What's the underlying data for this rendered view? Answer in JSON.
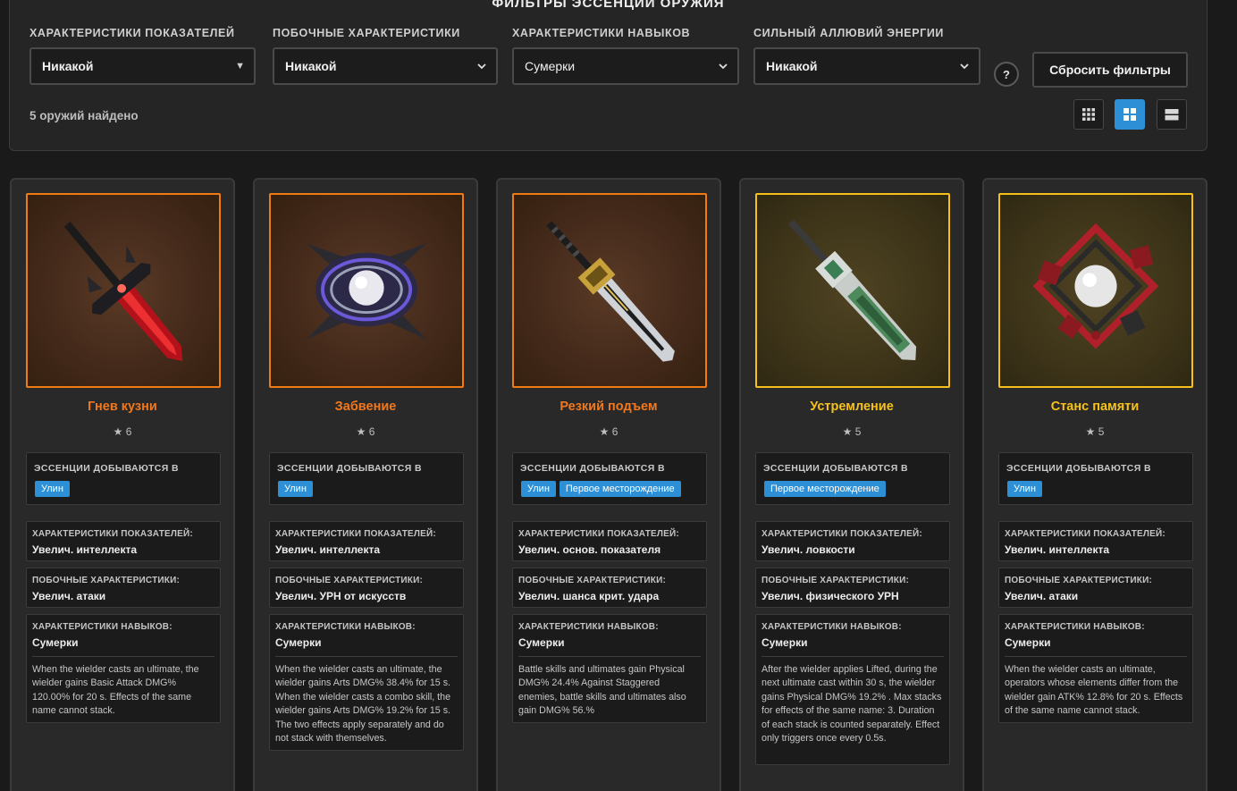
{
  "filters": {
    "title": "ФИЛЬТРЫ ЭССЕНЦИЙ ОРУЖИЯ",
    "groups": [
      {
        "label": "ХАРАКТЕРИСТИКИ ПОКАЗАТЕЛЕЙ",
        "value": "Никакой"
      },
      {
        "label": "ПОБОЧНЫЕ ХАРАКТЕРИСТИКИ",
        "value": "Никакой"
      },
      {
        "label": "ХАРАКТЕРИСТИКИ НАВЫКОВ",
        "value": "Сумерки"
      },
      {
        "label": "СИЛЬНЫЙ АЛЛЮВИЙ ЭНЕРГИИ",
        "value": "Никакой"
      }
    ],
    "help_label": "?",
    "reset_label": "Сбросить фильтры",
    "found_text": "5 оружий найдено",
    "view_modes": [
      "grid-small-icon",
      "grid-large-icon",
      "list-icon"
    ],
    "active_view": "grid-large-icon"
  },
  "labels": {
    "source": "ЭССЕНЦИИ ДОБЫВАЮТСЯ В",
    "primary": "ХАРАКТЕРИСТИКИ ПОКАЗАТЕЛЕЙ:",
    "secondary": "ПОБОЧНЫЕ ХАРАКТЕРИСТИКИ:",
    "skill": "ХАРАКТЕРИСТИКИ НАВЫКОВ:"
  },
  "colors": {
    "rarity6": "#f07b12",
    "rarity5": "#f6bf19",
    "accent": "#2d8fd6"
  },
  "weapons": [
    {
      "name": "Гнев кузни",
      "rarity": "★ 6",
      "sources": [
        "Улин"
      ],
      "primary": "Увелич. интеллекта",
      "secondary": "Увелич. атаки",
      "skill": "Сумерки",
      "skill_desc": "When the wielder casts an ultimate, the wielder gains Basic Attack DMG% 120.00% for 20 s. Effects of the same name cannot stack."
    },
    {
      "name": "Забвение",
      "rarity": "★ 6",
      "sources": [
        "Улин"
      ],
      "primary": "Увелич. интеллекта",
      "secondary": "Увелич. УРН от искусств",
      "skill": "Сумерки",
      "skill_desc": "When the wielder casts an ultimate, the wielder gains Arts DMG% 38.4% for 15 s. When the wielder casts a combo skill, the wielder gains Arts DMG% 19.2% for 15 s. The two effects apply separately and do not stack with themselves."
    },
    {
      "name": "Резкий подъем",
      "rarity": "★ 6",
      "sources": [
        "Улин",
        "Первое месторождение"
      ],
      "primary": "Увелич. основ. показателя",
      "secondary": "Увелич. шанса крит. удара",
      "skill": "Сумерки",
      "skill_desc": "Battle skills and ultimates gain Physical DMG% 24.4% Against Staggered enemies, battle skills and ultimates also gain DMG% 56.%"
    },
    {
      "name": "Устремление",
      "rarity": "★ 5",
      "sources": [
        "Первое месторождение"
      ],
      "primary": "Увелич. ловкости",
      "secondary": "Увелич. физического УРН",
      "skill": "Сумерки",
      "skill_desc": "After the wielder applies Lifted, during the next ultimate cast within 30 s, the wielder gains Physical DMG% 19.2% . Max stacks for effects of the same name: 3. Duration of each stack is counted separately. Effect only triggers once every 0.5s."
    },
    {
      "name": "Станс памяти",
      "rarity": "★ 5",
      "sources": [
        "Улин"
      ],
      "primary": "Увелич. интеллекта",
      "secondary": "Увелич. атаки",
      "skill": "Сумерки",
      "skill_desc": "When the wielder casts an ultimate, operators whose elements differ from the wielder gain ATK% 12.8% for 20 s. Effects of the same name cannot stack."
    }
  ]
}
